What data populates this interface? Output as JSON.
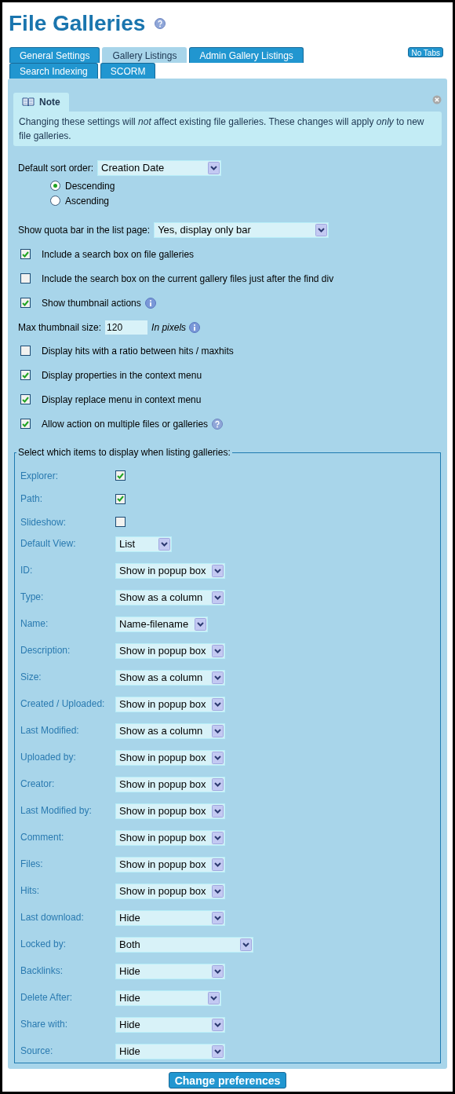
{
  "title": "File Galleries",
  "tabs": [
    {
      "label": "General Settings",
      "selected": false
    },
    {
      "label": "Gallery Listings",
      "selected": true
    },
    {
      "label": "Admin Gallery Listings",
      "selected": false
    },
    {
      "label": "Search Indexing",
      "selected": false
    },
    {
      "label": "SCORM",
      "selected": false
    }
  ],
  "no_tabs_button": "No Tabs",
  "note": {
    "title": "Note",
    "text": "Changing these settings will *not* affect existing file galleries. These changes will apply *only* to new file galleries."
  },
  "sort_order": {
    "label": "Default sort order:",
    "value": "Creation Date",
    "options": [
      {
        "label": "Descending",
        "selected": true
      },
      {
        "label": "Ascending",
        "selected": false
      }
    ]
  },
  "quota": {
    "label": "Show quota bar in the list page:",
    "value": "Yes, display only bar"
  },
  "checkboxes_top": [
    {
      "label": "Include a search box on file galleries",
      "checked": true,
      "kind": "plain"
    },
    {
      "label": "Include the search box on the current gallery files just after the find div",
      "checked": false,
      "kind": "plain"
    },
    {
      "label": "Show thumbnail actions",
      "checked": true,
      "kind": "info"
    }
  ],
  "max_thumbnail": {
    "label": "Max thumbnail size:",
    "value": "120",
    "unit": "In pixels"
  },
  "checkboxes_bottom": [
    {
      "label": "Display hits with a ratio between hits / maxhits",
      "checked": false,
      "kind": "plain"
    },
    {
      "label": "Display properties in the context menu",
      "checked": true,
      "kind": "plain"
    },
    {
      "label": "Display replace menu in context menu",
      "checked": true,
      "kind": "plain"
    },
    {
      "label": "Allow action on multiple files or galleries",
      "checked": true,
      "kind": "help"
    }
  ],
  "listing": {
    "legend": "Select which items to display when listing galleries:",
    "items": [
      {
        "label": "Explorer:",
        "kind": "checkbox",
        "checked": true
      },
      {
        "label": "Path:",
        "kind": "checkbox",
        "checked": true
      },
      {
        "label": "Slideshow:",
        "kind": "checkbox",
        "checked": false
      },
      {
        "label": "Default View:",
        "kind": "select",
        "value": "List"
      },
      {
        "label": "ID:",
        "kind": "select",
        "value": "Show in popup box"
      },
      {
        "label": "Type:",
        "kind": "select",
        "value": "Show as a column"
      },
      {
        "label": "Name:",
        "kind": "select",
        "value": "Name-filename"
      },
      {
        "label": "Description:",
        "kind": "select",
        "value": "Show in popup box"
      },
      {
        "label": "Size:",
        "kind": "select",
        "value": "Show as a column"
      },
      {
        "label": "Created / Uploaded:",
        "kind": "select",
        "value": "Show in popup box"
      },
      {
        "label": "Last Modified:",
        "kind": "select",
        "value": "Show as a column"
      },
      {
        "label": "Uploaded by:",
        "kind": "select",
        "value": "Show in popup box"
      },
      {
        "label": "Creator:",
        "kind": "select",
        "value": "Show in popup box"
      },
      {
        "label": "Last Modified by:",
        "kind": "select",
        "value": "Show in popup box"
      },
      {
        "label": "Comment:",
        "kind": "select",
        "value": "Show in popup box"
      },
      {
        "label": "Files:",
        "kind": "select",
        "value": "Show in popup box"
      },
      {
        "label": "Hits:",
        "kind": "select",
        "value": "Show in popup box"
      },
      {
        "label": "Last download:",
        "kind": "select",
        "value": "Hide"
      },
      {
        "label": "Locked by:",
        "kind": "select",
        "value": "Both"
      },
      {
        "label": "Backlinks:",
        "kind": "select",
        "value": "Hide"
      },
      {
        "label": "Delete After:",
        "kind": "select",
        "value": "Hide"
      },
      {
        "label": "Share with:",
        "kind": "select",
        "value": "Hide"
      },
      {
        "label": "Source:",
        "kind": "select",
        "value": "Hide"
      }
    ]
  },
  "submit": "Change preferences"
}
